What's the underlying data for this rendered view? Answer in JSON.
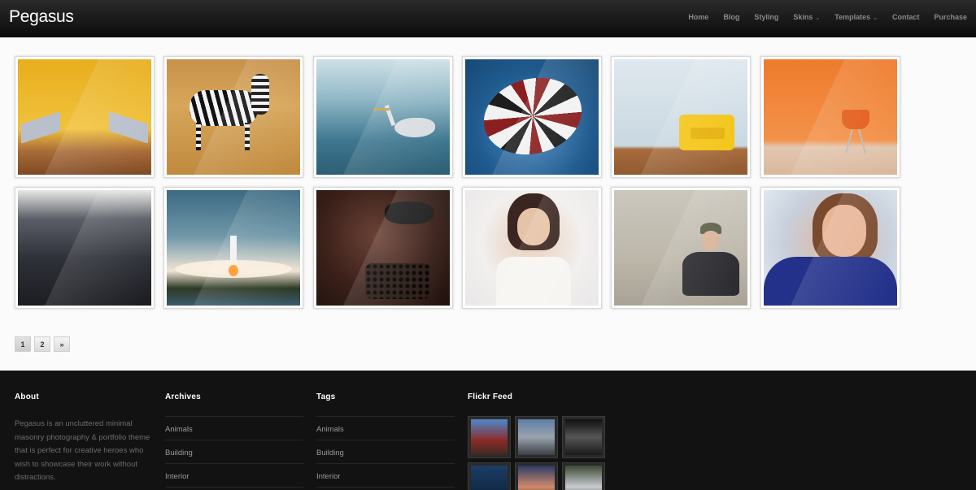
{
  "header": {
    "logo": "Pegasus",
    "nav": [
      {
        "label": "Home",
        "has_dropdown": false
      },
      {
        "label": "Blog",
        "has_dropdown": false
      },
      {
        "label": "Styling",
        "has_dropdown": false
      },
      {
        "label": "Skins",
        "has_dropdown": true
      },
      {
        "label": "Templates",
        "has_dropdown": true
      },
      {
        "label": "Contact",
        "has_dropdown": false
      },
      {
        "label": "Purchase",
        "has_dropdown": false
      }
    ],
    "dropdown_glyph": "⌄"
  },
  "gallery": {
    "items": [
      {
        "subject": "yellow-room-chairs-image"
      },
      {
        "subject": "zebra-image"
      },
      {
        "subject": "heron-image"
      },
      {
        "subject": "striped-umbrella-image"
      },
      {
        "subject": "yellow-armchair-image"
      },
      {
        "subject": "orange-room-chair-image"
      },
      {
        "subject": "misty-field-image"
      },
      {
        "subject": "rocket-launch-image"
      },
      {
        "subject": "woman-mask-image"
      },
      {
        "subject": "smiling-woman-sweater-image"
      },
      {
        "subject": "woman-sitting-cap-image"
      },
      {
        "subject": "smiling-woman-blue-image"
      }
    ]
  },
  "pagination": {
    "pages": [
      "1",
      "2",
      "»"
    ],
    "current": "1"
  },
  "footer": {
    "about": {
      "title": "About",
      "text": "Pegasus is an uncluttered minimal masonry photography & portfolio theme that is perfect for creative heroes who wish to showcase their work without distractions."
    },
    "archives": {
      "title": "Archives",
      "links": [
        "Animals",
        "Building",
        "Interior"
      ]
    },
    "tags": {
      "title": "Tags",
      "links": [
        "Animals",
        "Building",
        "Interior"
      ]
    },
    "flickr": {
      "title": "Flickr Feed"
    }
  }
}
